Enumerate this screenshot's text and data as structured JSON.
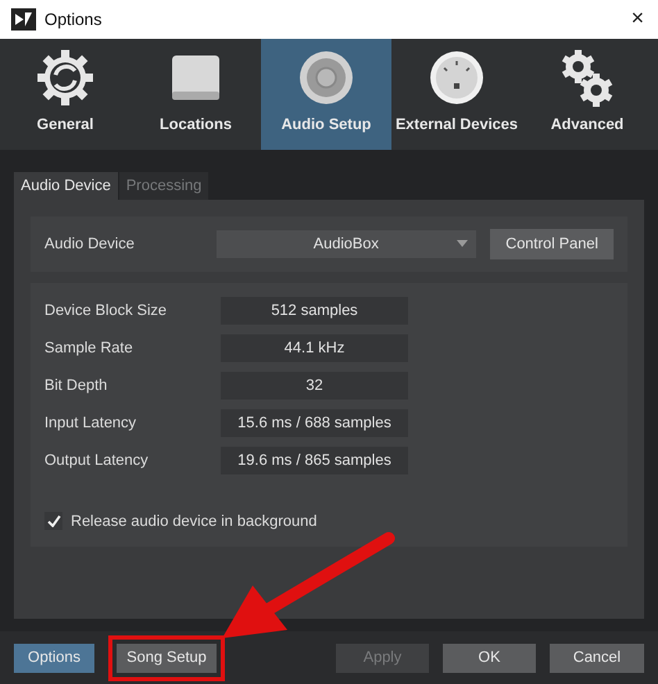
{
  "window": {
    "title": "Options",
    "close": "×"
  },
  "categories": [
    {
      "label": "General",
      "selected": false
    },
    {
      "label": "Locations",
      "selected": false
    },
    {
      "label": "Audio Setup",
      "selected": true
    },
    {
      "label": "External Devices",
      "selected": false
    },
    {
      "label": "Advanced",
      "selected": false
    }
  ],
  "subtabs": [
    {
      "label": "Audio Device",
      "selected": true
    },
    {
      "label": "Processing",
      "selected": false
    }
  ],
  "device": {
    "label": "Audio Device",
    "value": "AudioBox",
    "button": "Control Panel"
  },
  "settings": [
    {
      "label": "Device Block Size",
      "value": "512 samples"
    },
    {
      "label": "Sample Rate",
      "value": "44.1 kHz"
    },
    {
      "label": "Bit Depth",
      "value": "32"
    },
    {
      "label": "Input Latency",
      "value": "15.6 ms / 688 samples"
    },
    {
      "label": "Output Latency",
      "value": "19.6 ms / 865 samples"
    }
  ],
  "release_checkbox": {
    "label": "Release audio device in background",
    "checked": true
  },
  "footer_buttons": [
    {
      "label": "Options",
      "selected": true,
      "disabled": false,
      "highlighted": false
    },
    {
      "label": "Song Setup",
      "selected": false,
      "disabled": false,
      "highlighted": true
    },
    {
      "label": "Apply",
      "selected": false,
      "disabled": true,
      "highlighted": false
    },
    {
      "label": "OK",
      "selected": false,
      "disabled": false,
      "highlighted": false
    },
    {
      "label": "Cancel",
      "selected": false,
      "disabled": false,
      "highlighted": false
    }
  ]
}
